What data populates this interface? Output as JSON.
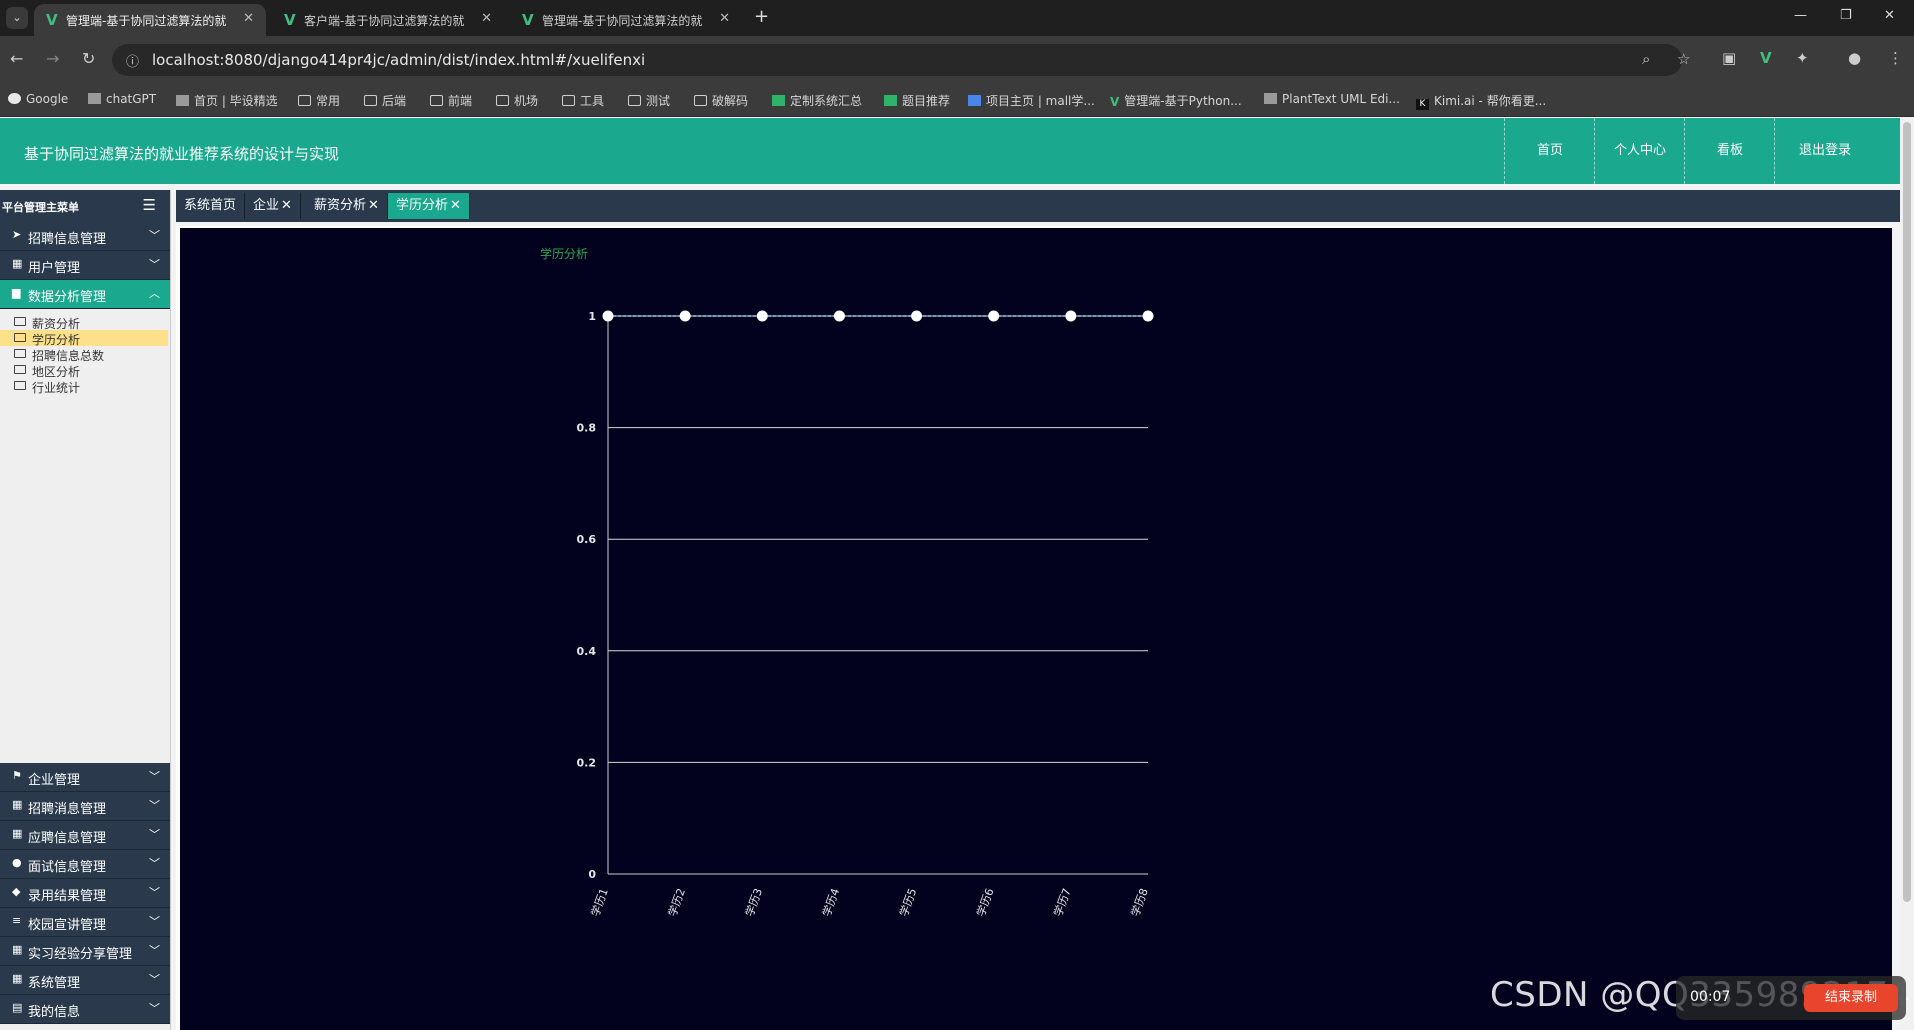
{
  "browser": {
    "tabs": [
      {
        "title": "管理端-基于协同过滤算法的就",
        "active": true
      },
      {
        "title": "客户端-基于协同过滤算法的就",
        "active": false
      },
      {
        "title": "管理端-基于协同过滤算法的就",
        "active": false
      }
    ],
    "url": "localhost:8080/django414pr4jc/admin/dist/index.html#/xuelifenxi",
    "bookmarks": [
      {
        "label": "Google",
        "icon": "google-icon"
      },
      {
        "label": "chatGPT",
        "icon": "chatgpt-icon"
      },
      {
        "label": "首页 | 毕设精选",
        "icon": "site-icon"
      },
      {
        "label": "常用",
        "icon": "folder-icon"
      },
      {
        "label": "后端",
        "icon": "folder-icon"
      },
      {
        "label": "前端",
        "icon": "folder-icon"
      },
      {
        "label": "机场",
        "icon": "folder-icon"
      },
      {
        "label": "工具",
        "icon": "folder-icon"
      },
      {
        "label": "测试",
        "icon": "folder-icon"
      },
      {
        "label": "破解码",
        "icon": "folder-icon"
      },
      {
        "label": "定制系统汇总",
        "icon": "sheet-icon"
      },
      {
        "label": "题目推荐",
        "icon": "sheet-icon"
      },
      {
        "label": "项目主页 | mall学...",
        "icon": "site-icon"
      },
      {
        "label": "管理端-基于Python...",
        "icon": "vue-icon"
      },
      {
        "label": "PlantText UML Edi...",
        "icon": "site-icon"
      },
      {
        "label": "Kimi.ai - 帮你看更...",
        "icon": "kimi-icon"
      }
    ]
  },
  "header": {
    "title": "基于协同过滤算法的就业推荐系统的设计与实现",
    "nav": [
      "首页",
      "个人中心",
      "看板",
      "退出登录"
    ]
  },
  "sidebar": {
    "title": "平台管理主菜单",
    "items_top": [
      {
        "label": "招聘信息管理",
        "icon": "send-icon"
      },
      {
        "label": "用户管理",
        "icon": "grid-icon"
      },
      {
        "label": "数据分析管理",
        "icon": "chart-icon",
        "open": true
      }
    ],
    "sub_items": [
      {
        "label": "薪资分析",
        "selected": false
      },
      {
        "label": "学历分析",
        "selected": true
      },
      {
        "label": "招聘信息总数",
        "selected": false
      },
      {
        "label": "地区分析",
        "selected": false
      },
      {
        "label": "行业统计",
        "selected": false
      }
    ],
    "items_bottom": [
      {
        "label": "企业管理",
        "icon": "flag-icon"
      },
      {
        "label": "招聘消息管理",
        "icon": "grid-icon"
      },
      {
        "label": "应聘信息管理",
        "icon": "grid-icon"
      },
      {
        "label": "面试信息管理",
        "icon": "user-icon"
      },
      {
        "label": "录用结果管理",
        "icon": "thumb-icon"
      },
      {
        "label": "校园宣讲管理",
        "icon": "list-icon"
      },
      {
        "label": "实习经验分享管理",
        "icon": "grid-icon"
      },
      {
        "label": "系统管理",
        "icon": "grid-icon"
      },
      {
        "label": "我的信息",
        "icon": "card-icon"
      }
    ]
  },
  "content_tabs": [
    {
      "label": "系统首页",
      "closable": false,
      "active": false
    },
    {
      "label": "企业",
      "closable": true,
      "active": false
    },
    {
      "label": "薪资分析",
      "closable": true,
      "active": false
    },
    {
      "label": "学历分析",
      "closable": true,
      "active": true
    }
  ],
  "chart_data": {
    "type": "line",
    "title": "学历分析",
    "categories": [
      "学历1",
      "学历2",
      "学历3",
      "学历4",
      "学历5",
      "学历6",
      "学历7",
      "学历8"
    ],
    "values": [
      1,
      1,
      1,
      1,
      1,
      1,
      1,
      1
    ],
    "ylim": [
      0,
      1
    ],
    "yticks": [
      "0",
      "0.2",
      "0.4",
      "0.6",
      "0.8",
      "1"
    ],
    "grid": true,
    "colors": {
      "line": "#8fd3f4",
      "point": "#ffffff",
      "axis": "#cccccc",
      "title": "#2fa84f"
    }
  },
  "overlay": {
    "watermark": "CSDN @QQ3359892174",
    "recorder_time": "00:07",
    "recorder_button": "结束录制"
  }
}
